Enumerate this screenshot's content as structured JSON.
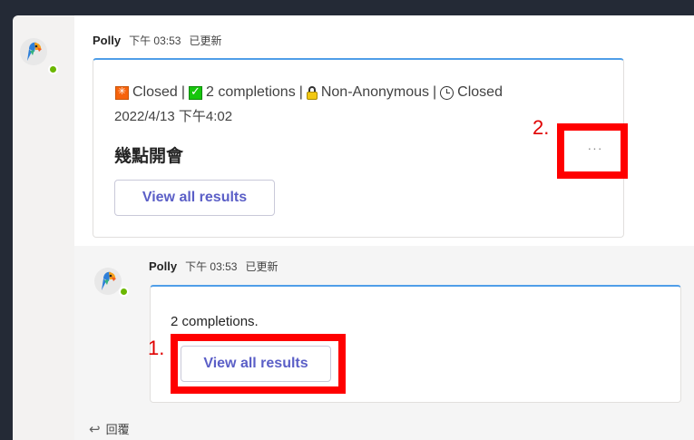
{
  "message1": {
    "sender": "Polly",
    "time": "下午 03:53",
    "edited": "已更新",
    "card": {
      "status": {
        "closed_label": "Closed",
        "completions": "2 completions",
        "anonymity": "Non-Anonymous",
        "deadline_label": "Closed",
        "separator": "|"
      },
      "date": "2022/4/13 下午4:02",
      "question": "幾點開會",
      "button_label": "View all results",
      "more_label": "···"
    }
  },
  "message2": {
    "sender": "Polly",
    "time": "下午 03:53",
    "edited": "已更新",
    "card": {
      "text": "2 completions.",
      "button_label": "View all results"
    }
  },
  "reply": {
    "label": "回覆"
  },
  "annotations": {
    "label1": "1.",
    "label2": "2.",
    "color": "#ff0000"
  },
  "colors": {
    "accent": "#5b5fc7",
    "card_top": "#4f9ee8",
    "presence": "#6bb700"
  },
  "icons": [
    "parrot-avatar-icon",
    "closed-status-icon",
    "check-icon",
    "lock-icon",
    "clock-icon",
    "reply-arrow-icon",
    "more-options-icon"
  ]
}
